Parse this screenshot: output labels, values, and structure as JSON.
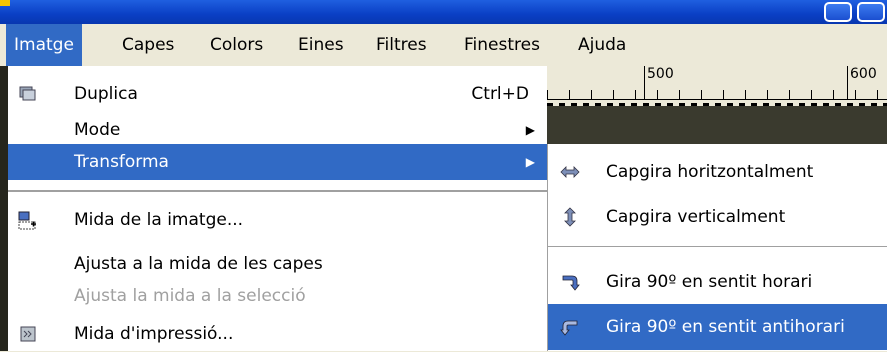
{
  "menubar": {
    "items": [
      {
        "label": "Imatge"
      },
      {
        "label": "Capes"
      },
      {
        "label": "Colors"
      },
      {
        "label": "Eines"
      },
      {
        "label": "Filtres"
      },
      {
        "label": "Finestres"
      },
      {
        "label": "Ajuda"
      }
    ],
    "active": "Imatge"
  },
  "ruler": {
    "labels": [
      "500",
      "600"
    ]
  },
  "image_menu": {
    "items": [
      {
        "label": "Duplica",
        "shortcut": "Ctrl+D",
        "icon": "duplicate-icon"
      },
      {
        "label": "Mode",
        "submenu": true
      },
      {
        "label": "Transforma",
        "submenu": true,
        "selected": true
      },
      {
        "label": "Mida de la imatge...",
        "icon": "image-size-icon"
      },
      {
        "label": "Ajusta a la mida de les capes"
      },
      {
        "label": "Ajusta la mida a la selecció",
        "disabled": true
      },
      {
        "label": "Mida d'impressió...",
        "icon": "print-size-icon"
      }
    ]
  },
  "transform_submenu": {
    "items": [
      {
        "label": "Capgira horitzontalment",
        "icon": "flip-horizontal-icon"
      },
      {
        "label": "Capgira verticalment",
        "icon": "flip-vertical-icon"
      },
      {
        "label": "Gira 90º en sentit horari",
        "icon": "rotate-clockwise-icon"
      },
      {
        "label": "Gira 90º en sentit antihorari",
        "icon": "rotate-counterclockwise-icon",
        "selected": true
      }
    ]
  },
  "colors": {
    "selection": "#316ac5",
    "menubar": "#ece9d8",
    "disabled_text": "#a0a0a0"
  }
}
